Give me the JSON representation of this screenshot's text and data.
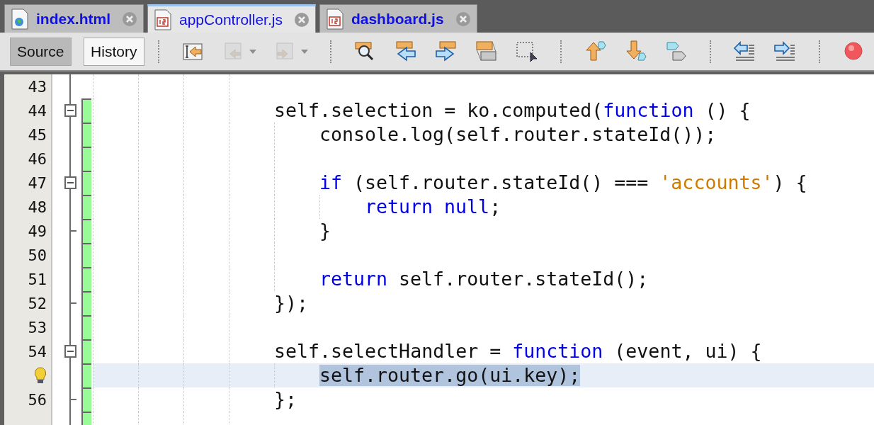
{
  "tabs": [
    {
      "label": "index.html",
      "selected": false,
      "kind": "html"
    },
    {
      "label": "appController.js",
      "selected": true,
      "kind": "js"
    },
    {
      "label": "dashboard.js",
      "selected": false,
      "kind": "js"
    }
  ],
  "toolbar": {
    "views": [
      {
        "label": "Source",
        "selected": true
      },
      {
        "label": "History",
        "selected": false
      }
    ],
    "tools": [
      {
        "kind": "separator"
      },
      {
        "kind": "tool",
        "disabled": false,
        "dropdown": false
      },
      {
        "kind": "tool",
        "disabled": true,
        "dropdown": true
      },
      {
        "kind": "tool",
        "disabled": true,
        "dropdown": true
      },
      {
        "kind": "separator"
      },
      {
        "kind": "tool",
        "disabled": false,
        "dropdown": false
      },
      {
        "kind": "tool",
        "disabled": false,
        "dropdown": false
      },
      {
        "kind": "tool",
        "disabled": false,
        "dropdown": false
      },
      {
        "kind": "tool",
        "disabled": false,
        "dropdown": false
      },
      {
        "kind": "tool",
        "disabled": false,
        "dropdown": false
      },
      {
        "kind": "separator"
      },
      {
        "kind": "tool",
        "disabled": false,
        "dropdown": false
      },
      {
        "kind": "tool",
        "disabled": false,
        "dropdown": false
      },
      {
        "kind": "tool",
        "disabled": false,
        "dropdown": false
      },
      {
        "kind": "separator"
      },
      {
        "kind": "tool",
        "disabled": false,
        "dropdown": false
      },
      {
        "kind": "tool",
        "disabled": false,
        "dropdown": false
      },
      {
        "kind": "separator"
      },
      {
        "kind": "tool",
        "disabled": false,
        "dropdown": false
      }
    ]
  },
  "editor": {
    "lines": [
      {
        "number": "43",
        "fold_start": false,
        "fold_end": false,
        "hint": false,
        "current": false
      },
      {
        "number": "44",
        "fold_start": true,
        "fold_end": false,
        "hint": false,
        "current": false,
        "tokens": [
          {
            "kind": "plain",
            "text": "self.selection = ko.computed("
          },
          {
            "kind": "keyword",
            "text": "function"
          },
          {
            "kind": "plain",
            "text": " () {"
          }
        ],
        "children": [
          {
            "number": "45",
            "fold_start": false,
            "fold_end": false,
            "hint": false,
            "current": false,
            "tokens": [
              {
                "kind": "plain",
                "text": "console.log(self.router.stateId());"
              }
            ]
          },
          {
            "number": "46",
            "fold_start": false,
            "fold_end": false,
            "hint": false,
            "current": false
          },
          {
            "number": "47",
            "fold_start": true,
            "fold_end": false,
            "hint": false,
            "current": false,
            "tokens": [
              {
                "kind": "keyword",
                "text": "if"
              },
              {
                "kind": "plain",
                "text": " (self.router.stateId() === "
              },
              {
                "kind": "string",
                "text": "'accounts'"
              },
              {
                "kind": "plain",
                "text": ") {"
              }
            ],
            "children": [
              {
                "number": "48",
                "fold_start": false,
                "fold_end": false,
                "hint": false,
                "current": false,
                "tokens": [
                  {
                    "kind": "keyword",
                    "text": "return null"
                  },
                  {
                    "kind": "plain",
                    "text": ";"
                  }
                ]
              }
            ]
          },
          {
            "number": "49",
            "fold_start": false,
            "fold_end": true,
            "hint": false,
            "current": false,
            "tokens": [
              {
                "kind": "plain",
                "text": "}"
              }
            ]
          },
          {
            "number": "50",
            "fold_start": false,
            "fold_end": false,
            "hint": false,
            "current": false
          },
          {
            "number": "51",
            "fold_start": false,
            "fold_end": false,
            "hint": false,
            "current": false,
            "tokens": [
              {
                "kind": "keyword",
                "text": "return"
              },
              {
                "kind": "plain",
                "text": " self.router.stateId();"
              }
            ]
          }
        ]
      },
      {
        "number": "52",
        "fold_start": false,
        "fold_end": true,
        "hint": false,
        "current": false,
        "tokens": [
          {
            "kind": "plain",
            "text": "});"
          }
        ]
      },
      {
        "number": "53",
        "fold_start": false,
        "fold_end": false,
        "hint": false,
        "current": false
      },
      {
        "number": "54",
        "fold_start": true,
        "fold_end": false,
        "hint": false,
        "current": false,
        "tokens": [
          {
            "kind": "plain",
            "text": "self.selectHandler = "
          },
          {
            "kind": "keyword",
            "text": "function"
          },
          {
            "kind": "plain",
            "text": " (event, ui) {"
          }
        ],
        "children": [
          {
            "fold_start": false,
            "fold_end": false,
            "hint": true,
            "current": true,
            "tokens": [
              {
                "kind": "selection",
                "text": "self.router.go(ui.key);"
              }
            ]
          }
        ]
      },
      {
        "number": "56",
        "fold_start": false,
        "fold_end": true,
        "hint": false,
        "current": false,
        "tokens": [
          {
            "kind": "plain",
            "text": "};"
          }
        ]
      },
      {
        "fold_start": false,
        "fold_end": false,
        "hint": false,
        "current": false
      }
    ]
  }
}
